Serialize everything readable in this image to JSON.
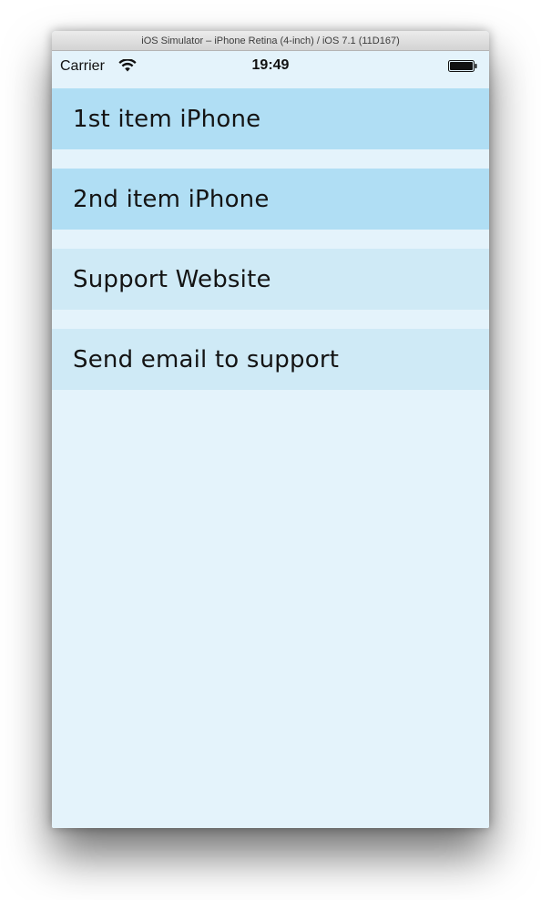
{
  "window": {
    "title": "iOS Simulator – iPhone Retina (4-inch) / iOS 7.1 (11D167)"
  },
  "status_bar": {
    "carrier": "Carrier",
    "time": "19:49",
    "wifi_icon": "wifi-icon",
    "battery_icon": "battery-icon"
  },
  "menu": {
    "items": [
      {
        "label": "1st item iPhone",
        "color": "#b0def4"
      },
      {
        "label": "2nd item iPhone",
        "color": "#b0def4"
      },
      {
        "label": "Support Website",
        "color": "#cfeaf6"
      },
      {
        "label": "Send email to support",
        "color": "#cfeaf6"
      }
    ]
  },
  "colors": {
    "background": "#e4f3fb",
    "item_primary": "#b0def4",
    "item_secondary": "#cfeaf6"
  }
}
